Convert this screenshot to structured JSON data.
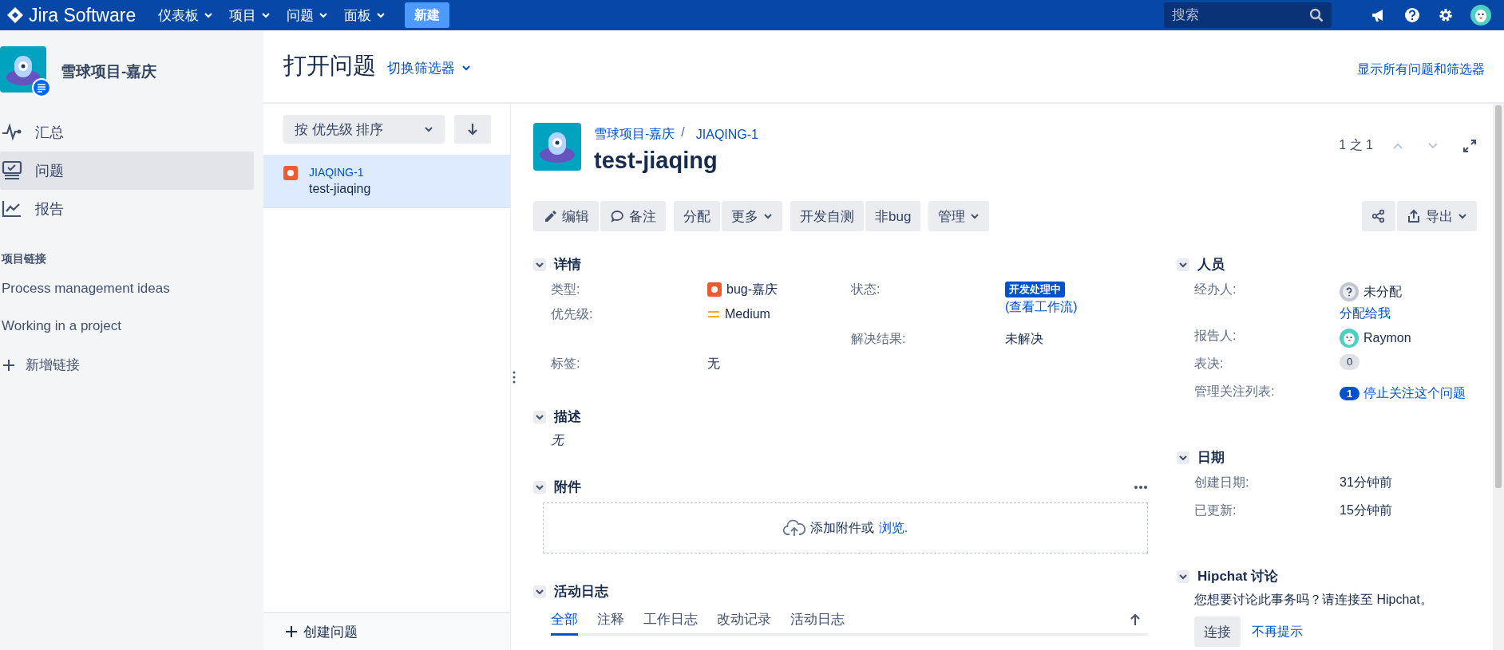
{
  "top_nav": {
    "logo": "Jira Software",
    "menus": [
      {
        "label": "仪表板"
      },
      {
        "label": "项目"
      },
      {
        "label": "问题"
      },
      {
        "label": "面板"
      }
    ],
    "create_button": "新建",
    "search": {
      "placeholder": "搜索"
    }
  },
  "sidebar": {
    "project_name": "雪球项目-嘉庆",
    "items": [
      {
        "label": "汇总",
        "selected": false
      },
      {
        "label": "问题",
        "selected": true
      },
      {
        "label": "报告",
        "selected": false
      }
    ],
    "links_heading": "项目链接",
    "links": [
      "Process management ideas",
      "Working in a project"
    ],
    "add_link": "新增链接"
  },
  "page_header": {
    "title": "打开问题",
    "filter_switch": "切换筛选器",
    "show_all": "显示所有问题和筛选器"
  },
  "issue_list": {
    "sort": "按 优先级 排序",
    "items": [
      {
        "key": "JIAQING-1",
        "summary": "test-jiaqing",
        "selected": true
      }
    ],
    "create": "创建问题"
  },
  "issue": {
    "breadcrumb_project": "雪球项目-嘉庆",
    "breadcrumb_separator": "/",
    "key": "JIAQING-1",
    "summary": "test-jiaqing",
    "pager": "1 之 1",
    "toolbar": [
      [
        {
          "label": "编辑",
          "dropdown": false
        },
        {
          "label": "备注",
          "dropdown": false
        }
      ],
      [
        {
          "label": "分配",
          "dropdown": false
        },
        {
          "label": "更多",
          "dropdown": true
        }
      ],
      [
        {
          "label": "开发自测",
          "dropdown": false
        },
        {
          "label": "非bug",
          "dropdown": false
        }
      ],
      [
        {
          "label": "管理",
          "dropdown": true
        }
      ]
    ],
    "export_button": "导出",
    "details": {
      "heading": "详情",
      "expanded": true,
      "left": [
        {
          "label": "类型:",
          "value": "bug-嘉庆",
          "kind": "issuetype"
        },
        {
          "label": "优先级:",
          "value": "Medium",
          "kind": "priority"
        },
        {
          "label": "标签:",
          "value": "无",
          "kind": "text"
        }
      ],
      "right": [
        {
          "label": "状态:",
          "value": "开发处理中",
          "kind": "status",
          "link": "(查看工作流)"
        },
        {
          "label": "解决结果:",
          "value": "未解决",
          "kind": "text"
        }
      ]
    },
    "description": {
      "heading": "描述",
      "expanded": true,
      "text": "无"
    },
    "attachments": {
      "heading": "附件",
      "expanded": true,
      "drop_text": "添加附件或",
      "browse_link": "浏览."
    },
    "activity": {
      "heading": "活动日志",
      "expanded": true,
      "tabs": [
        {
          "label": "全部",
          "selected": true
        },
        {
          "label": "注释",
          "selected": false
        },
        {
          "label": "工作日志",
          "selected": false
        },
        {
          "label": "改动记录",
          "selected": false
        },
        {
          "label": "活动日志",
          "selected": false
        }
      ]
    },
    "people": {
      "heading": "人员",
      "expanded": true,
      "fields": [
        {
          "label": "经办人:",
          "kind": "unassigned_user",
          "value": "未分配",
          "link": "分配给我"
        },
        {
          "label": "报告人:",
          "kind": "user",
          "value": "Raymon"
        },
        {
          "label": "表决:",
          "kind": "count",
          "value": "0",
          "active": false
        },
        {
          "label": "管理关注列表:",
          "kind": "count",
          "value": "1",
          "active": true,
          "link": "停止关注这个问题"
        }
      ]
    },
    "dates": {
      "heading": "日期",
      "expanded": true,
      "fields": [
        {
          "label": "创建日期:",
          "value": "31分钟前"
        },
        {
          "label": "已更新:",
          "value": "15分钟前"
        }
      ]
    },
    "hipchat": {
      "heading": "Hipchat 讨论",
      "expanded": true,
      "text": "您想要讨论此事务吗？请连接至 Hipchat。",
      "connect_button": "连接",
      "dismiss_link": "不再提示"
    }
  }
}
